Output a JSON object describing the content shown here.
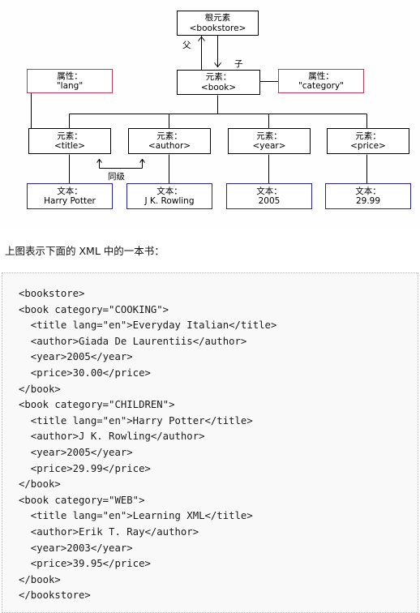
{
  "diagram": {
    "title": "XML DOM node tree for bookstore",
    "colors": {
      "element_border": "#000000",
      "attribute_border": "#cc3355",
      "text_border": "#2222aa",
      "line": "#000000",
      "page_background": "#ffffff",
      "code_background": "#f9f9f9",
      "code_border": "#bbbbbb"
    },
    "nodes": {
      "root": {
        "line1": "根元素",
        "line2": "<bookstore>"
      },
      "book": {
        "line1": "元素：",
        "line2": "<book>"
      },
      "attr_lang": {
        "line1": "属性：",
        "line2": "\"lang\""
      },
      "attr_category": {
        "line1": "属性：",
        "line2": "\"category\""
      },
      "el_title": {
        "line1": "元素：",
        "line2": "<title>"
      },
      "el_author": {
        "line1": "元素：",
        "line2": "<author>"
      },
      "el_year": {
        "line1": "元素：",
        "line2": "<year>"
      },
      "el_price": {
        "line1": "元素：",
        "line2": "<price>"
      },
      "text_title": {
        "line1": "文本：",
        "line2": "Harry Potter"
      },
      "text_author": {
        "line1": "文本：",
        "line2": "J K. Rowling"
      },
      "text_year": {
        "line1": "文本：",
        "line2": "2005"
      },
      "text_price": {
        "line1": "文本：",
        "line2": "29.99"
      }
    },
    "edge_labels": {
      "parent": "父",
      "child": "子",
      "sibling": "同级"
    }
  },
  "caption": {
    "text": "上图表示下面的 XML 中的一本书："
  },
  "code": {
    "language": "xml",
    "content": "<bookstore>\n<book category=\"COOKING\">\n  <title lang=\"en\">Everyday Italian</title>\n  <author>Giada De Laurentiis</author>\n  <year>2005</year>\n  <price>30.00</price>\n</book>\n<book category=\"CHILDREN\">\n  <title lang=\"en\">Harry Potter</title>\n  <author>J K. Rowling</author>\n  <year>2005</year>\n  <price>29.99</price>\n</book>\n<book category=\"WEB\">\n  <title lang=\"en\">Learning XML</title>\n  <author>Erik T. Ray</author>\n  <year>2003</year>\n  <price>39.95</price>\n</book>\n</bookstore>"
  }
}
